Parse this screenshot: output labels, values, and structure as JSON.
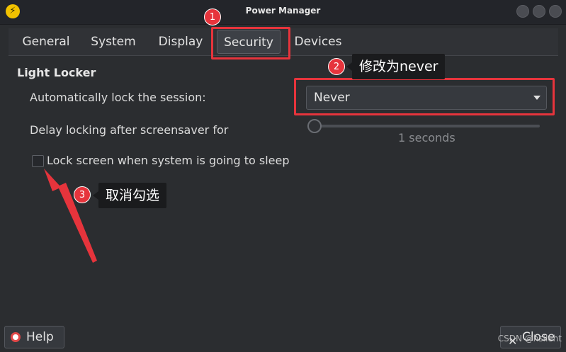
{
  "window": {
    "title": "Power Manager",
    "app_icon": "lightning-icon"
  },
  "tabs": [
    {
      "label": "General"
    },
    {
      "label": "System"
    },
    {
      "label": "Display"
    },
    {
      "label": "Security",
      "active": true
    },
    {
      "label": "Devices"
    }
  ],
  "light_locker": {
    "section_title": "Light Locker",
    "auto_lock_label": "Automatically lock the session:",
    "auto_lock_value": "Never",
    "delay_label": "Delay locking after screensaver for",
    "delay_value_text": "1 seconds",
    "delay_level": 0,
    "sleep_lock_label": "Lock screen when system is going to sleep",
    "sleep_lock_checked": false
  },
  "buttons": {
    "help_label": "Help",
    "close_label": "Close"
  },
  "annotations": {
    "marker_1": "1",
    "marker_2": "2",
    "marker_3": "3",
    "callout_2": "修改为never",
    "callout_3": "取消勾选"
  },
  "watermark": "CSDN @hsileht",
  "colors": {
    "annotation_red": "#e6343c",
    "background": "#2b2d30",
    "accent_icon": "#f2c200"
  }
}
